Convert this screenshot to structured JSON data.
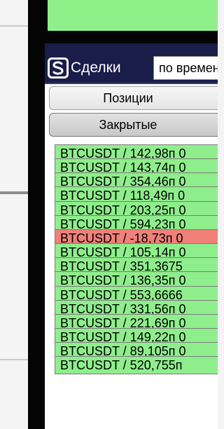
{
  "colors": {
    "banner": "#8ff08a",
    "header_bg": "#1a1d4a",
    "profit": "#8fee8c",
    "loss": "#f0807a"
  },
  "header": {
    "icon": "deals-logo-icon",
    "title": "Сделки",
    "sort_value": "по времени"
  },
  "tabs": [
    {
      "label": "Позиции"
    },
    {
      "label": "Закрытые"
    }
  ],
  "trades": [
    {
      "text": "BTCUSDT / 142,98п 0",
      "status": "profit"
    },
    {
      "text": "BTCUSDT / 143,74п 0",
      "status": "profit"
    },
    {
      "text": "BTCUSDT / 354,46п 0",
      "status": "profit"
    },
    {
      "text": "BTCUSDT / 118,49п 0",
      "status": "profit"
    },
    {
      "text": "BTCUSDT / 203,25п 0",
      "status": "profit"
    },
    {
      "text": "BTCUSDT / 594,23п 0",
      "status": "profit"
    },
    {
      "text": "BTCUSDT / -18,73п 0",
      "status": "loss"
    },
    {
      "text": "BTCUSDT / 105,14п 0",
      "status": "profit"
    },
    {
      "text": "BTCUSDT / 351,3675",
      "status": "profit"
    },
    {
      "text": "BTCUSDT / 136,35п 0",
      "status": "profit"
    },
    {
      "text": "BTCUSDT / 553,6666",
      "status": "profit"
    },
    {
      "text": "BTCUSDT / 331,56п 0",
      "status": "profit"
    },
    {
      "text": "BTCUSDT / 221,69п 0",
      "status": "profit"
    },
    {
      "text": "BTCUSDT / 149,22п 0",
      "status": "profit"
    },
    {
      "text": "BTCUSDT / 89,105п 0",
      "status": "profit"
    },
    {
      "text": "BTCUSDT / 520,755п",
      "status": "profit"
    }
  ]
}
